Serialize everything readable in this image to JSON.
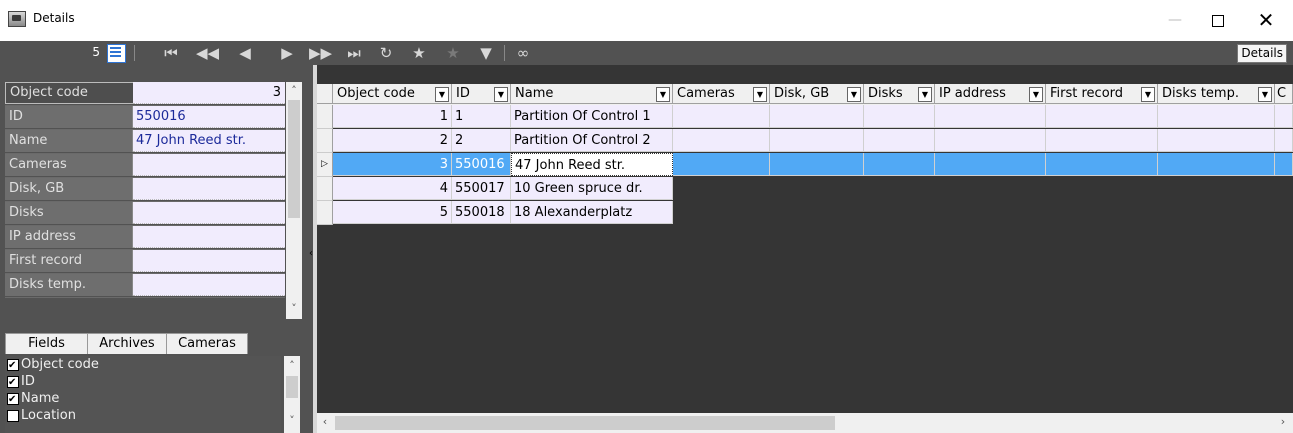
{
  "window": {
    "title": "Details",
    "minimize": "—",
    "close": "✕"
  },
  "toolbar": {
    "record_count": "5",
    "details_label": "Details",
    "icons": [
      "first-icon",
      "prev-page-icon",
      "prev-icon",
      "next-icon",
      "next-page-icon",
      "last-icon",
      "refresh-icon",
      "star-icon",
      "star-add-icon",
      "filter-icon",
      "link-icon"
    ]
  },
  "properties": [
    {
      "name": "Object code",
      "value": "3"
    },
    {
      "name": "ID",
      "value": "550016"
    },
    {
      "name": "Name",
      "value": "47 John Reed str."
    },
    {
      "name": "Cameras",
      "value": ""
    },
    {
      "name": "Disk, GB",
      "value": ""
    },
    {
      "name": "Disks",
      "value": ""
    },
    {
      "name": "IP address",
      "value": ""
    },
    {
      "name": "First record",
      "value": ""
    },
    {
      "name": "Disks temp.",
      "value": ""
    }
  ],
  "tabs": [
    "Fields",
    "Archives",
    "Cameras"
  ],
  "fields": [
    {
      "label": "Object code",
      "checked": true
    },
    {
      "label": "ID",
      "checked": true
    },
    {
      "label": "Name",
      "checked": true
    },
    {
      "label": "Location",
      "checked": false
    }
  ],
  "grid": {
    "columns": [
      "Object code",
      "ID",
      "Name",
      "Cameras",
      "Disk, GB",
      "Disks",
      "IP address",
      "First record",
      "Disks temp.",
      "C"
    ],
    "rows": [
      {
        "code": "1",
        "id": "1",
        "name": "Partition  Of Control 1"
      },
      {
        "code": "2",
        "id": "2",
        "name": "Partition  Of Control 2"
      },
      {
        "code": "3",
        "id": "550016",
        "name": "47 John Reed str."
      },
      {
        "code": "4",
        "id": "550017",
        "name": "10 Green spruce dr."
      },
      {
        "code": "5",
        "id": "550018",
        "name": "18 Alexanderplatz"
      }
    ],
    "selected_row": 2
  },
  "colors": {
    "toolbar_bg": "#525252",
    "selection": "#51a9f5",
    "cell_bg": "#f1ecfd",
    "value_text": "#1c2a9a"
  }
}
